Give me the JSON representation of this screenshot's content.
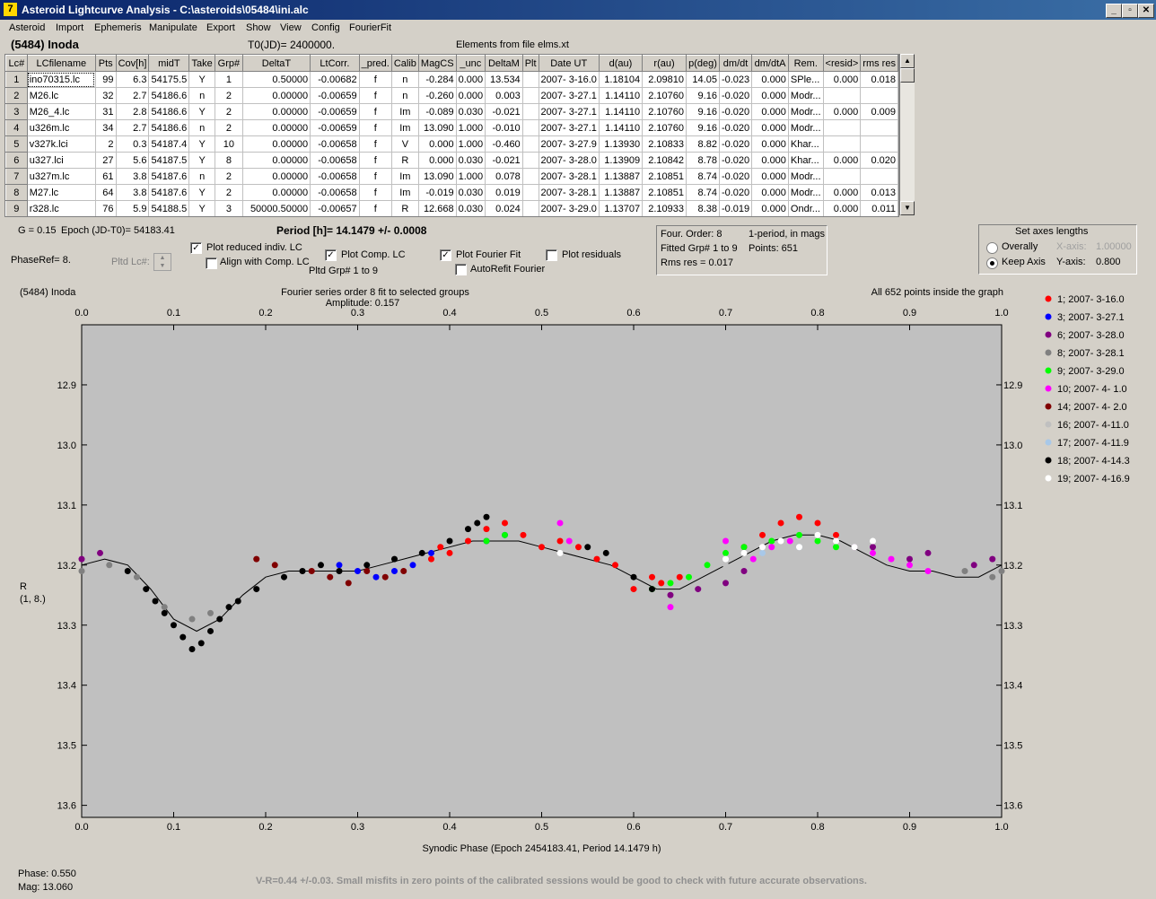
{
  "window": {
    "title": "Asteroid Lightcurve Analysis - C:\\asteroids\\05484\\ini.alc",
    "minimize": "_",
    "restore": "▫",
    "close": "✕"
  },
  "menu": [
    "Asteroid",
    "Import",
    "Ephemeris",
    "Manipulate",
    "Export",
    "Show",
    "View",
    "Config",
    "FourierFit"
  ],
  "header": {
    "object": "(5484) Inoda",
    "t0": "T0(JD)= 2400000.",
    "elements": "Elements from file elms.xt"
  },
  "table": {
    "columns": [
      "Lc#",
      "LCfilename",
      "Pts",
      "Cov[h]",
      "midT",
      "Take",
      "Grp#",
      "DeltaT",
      "LtCorr.",
      "_pred.",
      "Calib",
      "MagCS",
      "_unc",
      "DeltaM",
      "Plt",
      "Date UT",
      "d(au)",
      "r(au)",
      "p(deg)",
      "dm/dt",
      "dm/dtA",
      "Rem.",
      "<resid>",
      "rms res"
    ],
    "rows": [
      [
        "1",
        "ino70315.lc",
        "99",
        "6.3",
        "54175.5",
        "Y",
        "1",
        "0.50000",
        "-0.00682",
        "f",
        "n",
        "-0.284",
        "0.000",
        "13.534",
        "",
        "2007- 3-16.0",
        "1.18104",
        "2.09810",
        "14.05",
        "-0.023",
        "0.000",
        "SPle...",
        "0.000",
        "0.018"
      ],
      [
        "2",
        "M26.lc",
        "32",
        "2.7",
        "54186.6",
        "n",
        "2",
        "0.00000",
        "-0.00659",
        "f",
        "n",
        "-0.260",
        "0.000",
        "0.003",
        "",
        "2007- 3-27.1",
        "1.14110",
        "2.10760",
        "9.16",
        "-0.020",
        "0.000",
        "Modr...",
        "",
        ""
      ],
      [
        "3",
        "M26_4.lc",
        "31",
        "2.8",
        "54186.6",
        "Y",
        "2",
        "0.00000",
        "-0.00659",
        "f",
        "Im",
        "-0.089",
        "0.030",
        "-0.021",
        "",
        "2007- 3-27.1",
        "1.14110",
        "2.10760",
        "9.16",
        "-0.020",
        "0.000",
        "Modr...",
        "0.000",
        "0.009"
      ],
      [
        "4",
        "u326m.lc",
        "34",
        "2.7",
        "54186.6",
        "n",
        "2",
        "0.00000",
        "-0.00659",
        "f",
        "Im",
        "13.090",
        "1.000",
        "-0.010",
        "",
        "2007- 3-27.1",
        "1.14110",
        "2.10760",
        "9.16",
        "-0.020",
        "0.000",
        "Modr...",
        "",
        ""
      ],
      [
        "5",
        "v327k.lci",
        "2",
        "0.3",
        "54187.4",
        "Y",
        "10",
        "0.00000",
        "-0.00658",
        "f",
        "V",
        "0.000",
        "1.000",
        "-0.460",
        "",
        "2007- 3-27.9",
        "1.13930",
        "2.10833",
        "8.82",
        "-0.020",
        "0.000",
        "Khar...",
        "",
        ""
      ],
      [
        "6",
        "u327.lci",
        "27",
        "5.6",
        "54187.5",
        "Y",
        "8",
        "0.00000",
        "-0.00658",
        "f",
        "R",
        "0.000",
        "0.030",
        "-0.021",
        "",
        "2007- 3-28.0",
        "1.13909",
        "2.10842",
        "8.78",
        "-0.020",
        "0.000",
        "Khar...",
        "0.000",
        "0.020"
      ],
      [
        "7",
        "u327m.lc",
        "61",
        "3.8",
        "54187.6",
        "n",
        "2",
        "0.00000",
        "-0.00658",
        "f",
        "Im",
        "13.090",
        "1.000",
        "0.078",
        "",
        "2007- 3-28.1",
        "1.13887",
        "2.10851",
        "8.74",
        "-0.020",
        "0.000",
        "Modr...",
        "",
        ""
      ],
      [
        "8",
        "M27.lc",
        "64",
        "3.8",
        "54187.6",
        "Y",
        "2",
        "0.00000",
        "-0.00658",
        "f",
        "Im",
        "-0.019",
        "0.030",
        "0.019",
        "",
        "2007- 3-28.1",
        "1.13887",
        "2.10851",
        "8.74",
        "-0.020",
        "0.000",
        "Modr...",
        "0.000",
        "0.013"
      ],
      [
        "9",
        "r328.lc",
        "76",
        "5.9",
        "54188.5",
        "Y",
        "3",
        "50000.50000",
        "-0.00657",
        "f",
        "R",
        "12.668",
        "0.030",
        "0.024",
        "",
        "2007- 3-29.0",
        "1.13707",
        "2.10933",
        "8.38",
        "-0.019",
        "0.000",
        "Ondr...",
        "0.000",
        "0.011"
      ]
    ]
  },
  "controls": {
    "g": "G = 0.15",
    "epoch": "Epoch (JD-T0)= 54183.41",
    "period": "Period [h]= 14.1479 +/- 0.0008",
    "phaseref": "PhaseRef= 8.",
    "pltd_lc": "Pltd Lc#:",
    "plot_reduced": "Plot reduced indiv. LC",
    "align_comp": "Align with Comp. LC",
    "plot_comp": "Plot Comp. LC",
    "pltd_grp": "Pltd Grp#  1   to   9",
    "plot_fourier": "Plot Fourier Fit",
    "autorefit": "AutoRefit Fourier",
    "plot_residuals": "Plot residuals",
    "checks": {
      "plot_reduced": true,
      "align_comp": false,
      "plot_comp": true,
      "plot_fourier": true,
      "autorefit": false,
      "plot_residuals": false
    }
  },
  "fourier_info": {
    "order": "Four. Order:  8",
    "mode": "1-period, in mags",
    "fitted": "Fitted Grp# 1 to 9",
    "points": "Points: 651",
    "rms": "Rms res     = 0.017"
  },
  "axes_box": {
    "title": "Set axes lengths",
    "overally": "Overally",
    "keep_axis": "Keep Axis",
    "xaxis_label": "X-axis:",
    "xaxis_value": "1.00000",
    "yaxis_label": "Y-axis:",
    "yaxis_value": "0.800",
    "selected": "keep_axis"
  },
  "plot": {
    "object": "(5484) Inoda",
    "title": "Fourier series order 8 fit to selected groups",
    "amplitude": "Amplitude: 0.157",
    "inside": "All 652 points inside the graph",
    "ylabel1": "R",
    "ylabel2": "(1, 8.)",
    "xlabel": "Synodic Phase (Epoch 2454183.41, Period 14.1479 h)"
  },
  "chart_data": {
    "type": "scatter",
    "x_ticks": [
      "0.0",
      "0.1",
      "0.2",
      "0.3",
      "0.4",
      "0.5",
      "0.6",
      "0.7",
      "0.8",
      "0.9",
      "1.0"
    ],
    "y_ticks": [
      "12.9",
      "13.0",
      "13.1",
      "13.2",
      "13.3",
      "13.4",
      "13.5",
      "13.6"
    ],
    "xlim": [
      0,
      1
    ],
    "ylim": [
      13.62,
      12.8
    ],
    "y_inverted": true,
    "series": [
      {
        "name": "1; 2007- 3-16.0",
        "color": "#ff0000",
        "x": [
          0.38,
          0.39,
          0.4,
          0.42,
          0.44,
          0.46,
          0.48,
          0.5,
          0.52,
          0.54,
          0.56,
          0.58,
          0.6,
          0.62,
          0.63,
          0.65,
          0.72,
          0.74,
          0.76,
          0.78,
          0.8,
          0.82
        ],
        "y": [
          13.19,
          13.17,
          13.18,
          13.16,
          13.14,
          13.13,
          13.15,
          13.17,
          13.16,
          13.17,
          13.19,
          13.2,
          13.24,
          13.22,
          13.23,
          13.22,
          13.17,
          13.15,
          13.13,
          13.12,
          13.13,
          13.15
        ]
      },
      {
        "name": "3; 2007- 3-27.1",
        "color": "#0000ff",
        "x": [
          0.28,
          0.3,
          0.32,
          0.34,
          0.36,
          0.38,
          0.44,
          0.46
        ],
        "y": [
          13.2,
          13.21,
          13.22,
          13.21,
          13.2,
          13.18,
          13.16,
          13.15
        ]
      },
      {
        "name": "6; 2007- 3-28.0",
        "color": "#800080",
        "x": [
          0.0,
          0.02,
          0.64,
          0.67,
          0.7,
          0.72,
          0.84,
          0.86,
          0.9,
          0.92,
          0.97,
          0.99
        ],
        "y": [
          13.19,
          13.18,
          13.25,
          13.24,
          13.23,
          13.21,
          13.17,
          13.17,
          13.19,
          13.18,
          13.2,
          13.19
        ]
      },
      {
        "name": "8; 2007- 3-28.1",
        "color": "#808080",
        "x": [
          0.0,
          0.03,
          0.06,
          0.09,
          0.12,
          0.14,
          0.96,
          0.99,
          1.0
        ],
        "y": [
          13.21,
          13.2,
          13.22,
          13.27,
          13.29,
          13.28,
          13.21,
          13.22,
          13.21
        ]
      },
      {
        "name": "9; 2007- 3-29.0",
        "color": "#00ff00",
        "x": [
          0.44,
          0.46,
          0.62,
          0.64,
          0.66,
          0.68,
          0.7,
          0.72,
          0.75,
          0.78,
          0.8,
          0.82
        ],
        "y": [
          13.16,
          13.15,
          13.24,
          13.23,
          13.22,
          13.2,
          13.18,
          13.17,
          13.16,
          13.15,
          13.16,
          13.17
        ]
      },
      {
        "name": "10; 2007- 4- 1.0",
        "color": "#ff00ff",
        "x": [
          0.52,
          0.53,
          0.64,
          0.7,
          0.73,
          0.75,
          0.77,
          0.86,
          0.88,
          0.9,
          0.92
        ],
        "y": [
          13.13,
          13.16,
          13.27,
          13.16,
          13.19,
          13.17,
          13.16,
          13.18,
          13.19,
          13.2,
          13.21
        ]
      },
      {
        "name": "14; 2007- 4- 2.0",
        "color": "#800000",
        "x": [
          0.19,
          0.21,
          0.25,
          0.27,
          0.29,
          0.31,
          0.33,
          0.35
        ],
        "y": [
          13.19,
          13.2,
          13.21,
          13.22,
          13.23,
          13.21,
          13.22,
          13.21
        ]
      },
      {
        "name": "16; 2007- 4-11.0",
        "color": "#c0c0c0",
        "x": [
          0.7,
          0.72,
          0.8,
          0.84
        ],
        "y": [
          13.2,
          13.19,
          13.18,
          13.17
        ]
      },
      {
        "name": "17; 2007- 4-11.9",
        "color": "#a8c8e8",
        "x": [
          0.74,
          0.78
        ],
        "y": [
          13.18,
          13.17
        ]
      },
      {
        "name": "18; 2007- 4-14.3",
        "color": "#000000",
        "x": [
          0.05,
          0.07,
          0.08,
          0.09,
          0.1,
          0.11,
          0.12,
          0.13,
          0.14,
          0.15,
          0.16,
          0.17,
          0.19,
          0.22,
          0.24,
          0.26,
          0.28,
          0.31,
          0.34,
          0.37,
          0.4,
          0.42,
          0.43,
          0.44,
          0.55,
          0.57,
          0.6,
          0.62
        ],
        "y": [
          13.21,
          13.24,
          13.26,
          13.28,
          13.3,
          13.32,
          13.34,
          13.33,
          13.31,
          13.29,
          13.27,
          13.26,
          13.24,
          13.22,
          13.21,
          13.2,
          13.21,
          13.2,
          13.19,
          13.18,
          13.16,
          13.14,
          13.13,
          13.12,
          13.17,
          13.18,
          13.22,
          13.24
        ]
      },
      {
        "name": "19; 2007- 4-16.9",
        "color": "#ffffff",
        "x": [
          0.52,
          0.7,
          0.72,
          0.74,
          0.76,
          0.78,
          0.8,
          0.82,
          0.84,
          0.86
        ],
        "y": [
          13.18,
          13.19,
          13.18,
          13.17,
          13.16,
          13.17,
          13.15,
          13.16,
          13.17,
          13.16
        ]
      }
    ],
    "fit": {
      "x": [
        0.0,
        0.025,
        0.05,
        0.075,
        0.1,
        0.125,
        0.15,
        0.175,
        0.2,
        0.225,
        0.25,
        0.275,
        0.3,
        0.325,
        0.35,
        0.375,
        0.4,
        0.425,
        0.45,
        0.475,
        0.5,
        0.525,
        0.55,
        0.575,
        0.6,
        0.625,
        0.65,
        0.675,
        0.7,
        0.725,
        0.75,
        0.775,
        0.8,
        0.825,
        0.85,
        0.875,
        0.9,
        0.925,
        0.95,
        0.975,
        1.0
      ],
      "y": [
        13.2,
        13.19,
        13.2,
        13.24,
        13.29,
        13.31,
        13.29,
        13.25,
        13.22,
        13.21,
        13.21,
        13.21,
        13.21,
        13.2,
        13.19,
        13.18,
        13.17,
        13.16,
        13.16,
        13.16,
        13.17,
        13.18,
        13.19,
        13.2,
        13.22,
        13.24,
        13.24,
        13.22,
        13.2,
        13.18,
        13.16,
        13.15,
        13.15,
        13.16,
        13.18,
        13.2,
        13.21,
        13.21,
        13.22,
        13.22,
        13.2
      ]
    }
  },
  "status": {
    "phase": "Phase:  0.550",
    "mag": "Mag:    13.060",
    "message": "V-R=0.44 +/-0.03.  Small misfits in zero points of the calibrated sessions would be good to check with future accurate observations."
  }
}
